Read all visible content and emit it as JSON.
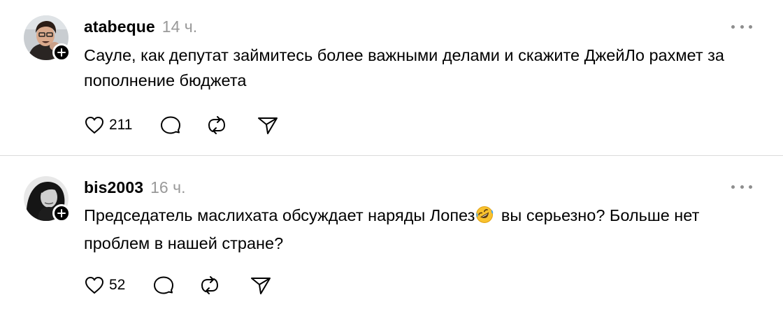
{
  "posts": [
    {
      "username": "atabeque",
      "time": "14 ч.",
      "text": "Сауле, как депутат займитесь более важными делами и скажите ДжейЛо рахмет за пополнение бюджета",
      "text_after_emoji": "",
      "likes": "211",
      "avatar_icon": "person-photo-icon",
      "badge_icon": "plus-icon"
    },
    {
      "username": "bis2003",
      "time": "16 ч.",
      "text": "Председатель маслихата обсуждает наряды Лопез",
      "emoji_icon": "rolling-on-floor-laughing-emoji",
      "text_after_emoji": " вы серьезно? Больше нет проблем в нашей стране?",
      "likes": "52",
      "avatar_icon": "person-photo-icon",
      "badge_icon": "plus-icon"
    }
  ],
  "icons": {
    "like": "heart-icon",
    "comment": "comment-bubble-icon",
    "repost": "repost-icon",
    "share": "send-icon",
    "more": "more-dots-icon"
  },
  "colors": {
    "background": "#ffffff",
    "time_text": "#999999",
    "divider": "#dbdbdb",
    "icon_stroke": "#000000"
  }
}
